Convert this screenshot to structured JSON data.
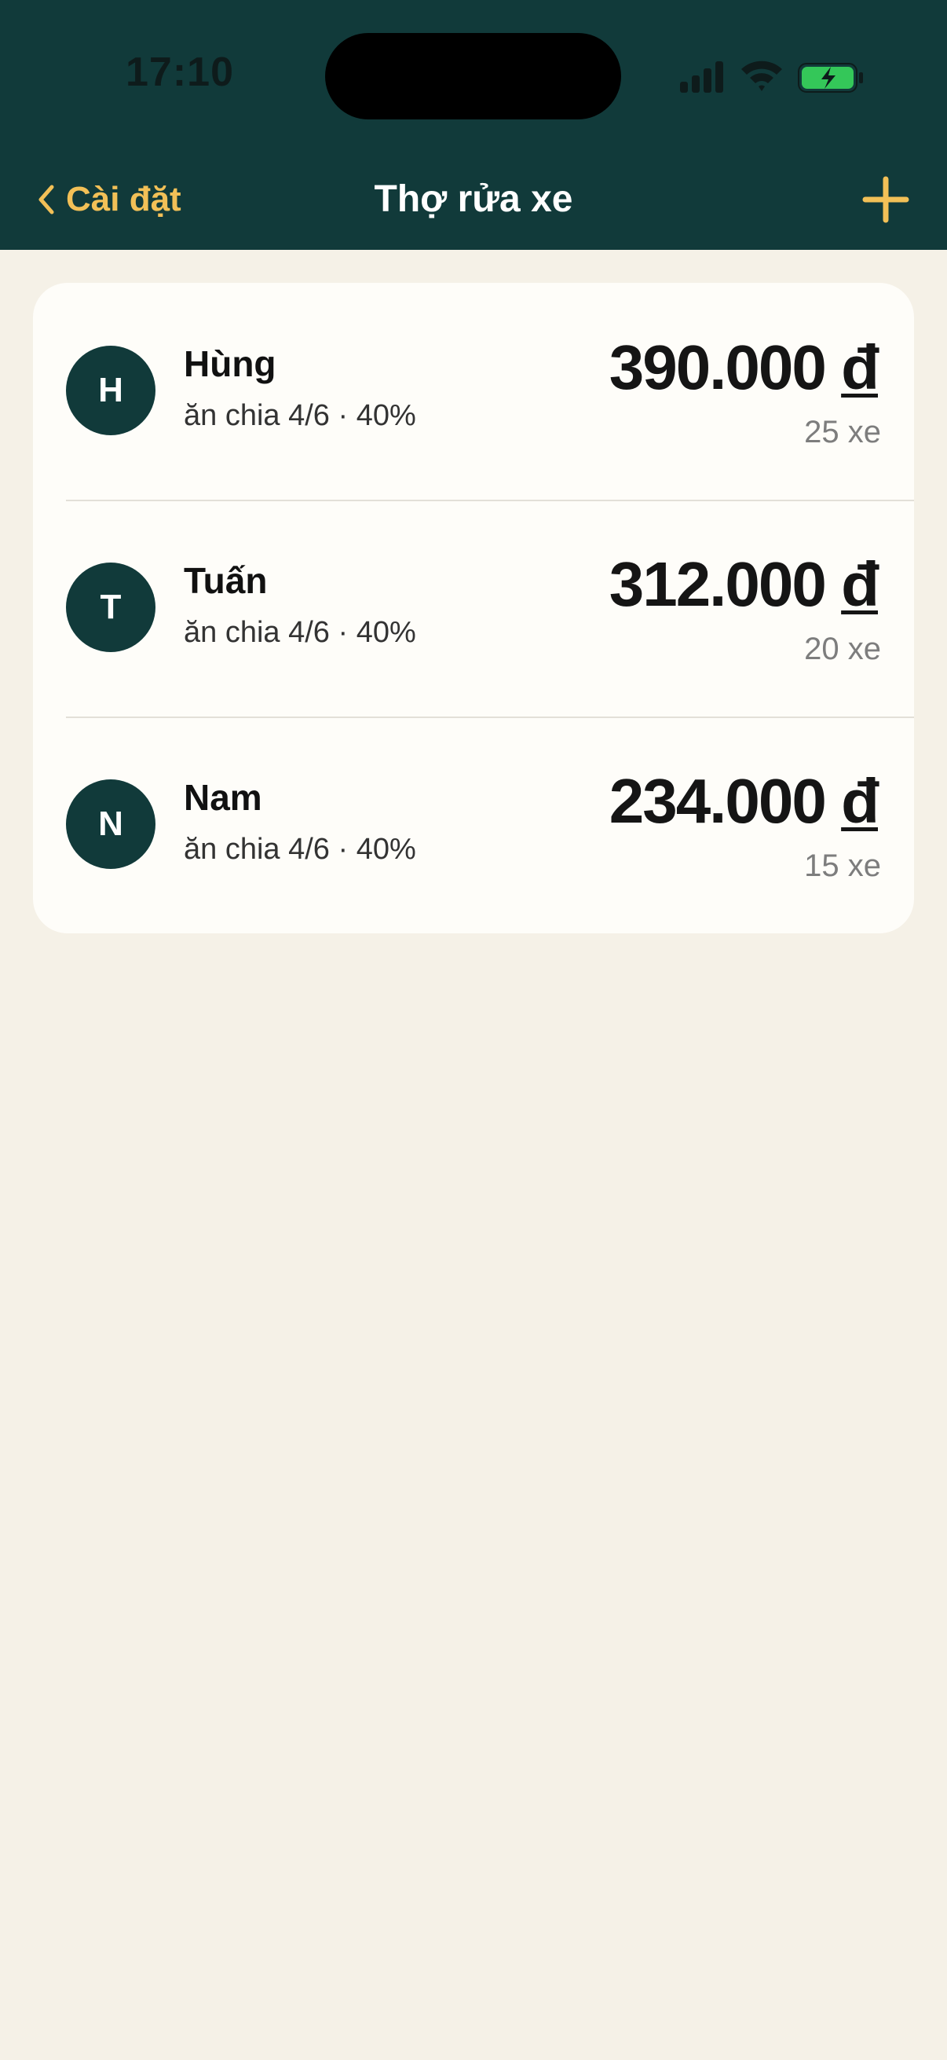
{
  "status_bar": {
    "time": "17:10"
  },
  "nav": {
    "back_label": "Cài đặt",
    "title": "Thợ rửa xe",
    "accent_color": "#f2c057",
    "header_color": "#113a3a"
  },
  "workers": [
    {
      "initial": "H",
      "name": "Hùng",
      "subtitle": "ăn chia 4/6 · 40%",
      "amount": "390.000",
      "currency": "đ",
      "count": "25 xe"
    },
    {
      "initial": "T",
      "name": "Tuấn",
      "subtitle": "ăn chia 4/6 · 40%",
      "amount": "312.000",
      "currency": "đ",
      "count": "20 xe"
    },
    {
      "initial": "N",
      "name": "Nam",
      "subtitle": "ăn chia 4/6 · 40%",
      "amount": "234.000",
      "currency": "đ",
      "count": "15 xe"
    }
  ]
}
